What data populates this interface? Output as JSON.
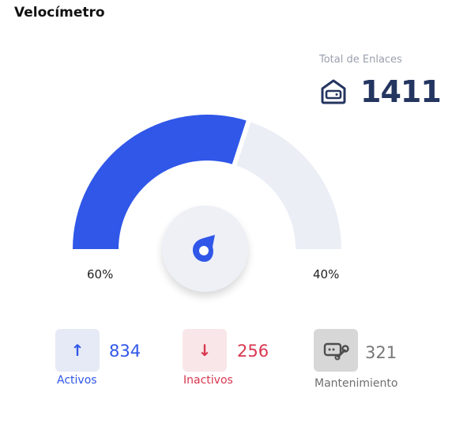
{
  "widget": {
    "title": "Velocímetro"
  },
  "total": {
    "label": "Total de Enlaces",
    "value": "1411",
    "icon": "router-icon"
  },
  "gauge": {
    "active_fraction": 0.6,
    "left_label": "60%",
    "right_label": "40%",
    "colors": {
      "active": "#3057e8",
      "inactive": "#eceef6",
      "center_icon": "#3057e8"
    },
    "center_icon": "pin-icon"
  },
  "stats": {
    "activos": {
      "icon": "arrow-up-icon",
      "glyph": "↑",
      "value": "834",
      "label": "Activos",
      "color": "#2f56e8"
    },
    "inactivos": {
      "icon": "arrow-down-icon",
      "glyph": "↓",
      "value": "256",
      "label": "Inactivos",
      "color": "#d9364f"
    },
    "mantenimiento": {
      "icon": "router-wrench-icon",
      "value": "321",
      "label": "Mantenimiento",
      "color": "#777777"
    }
  }
}
